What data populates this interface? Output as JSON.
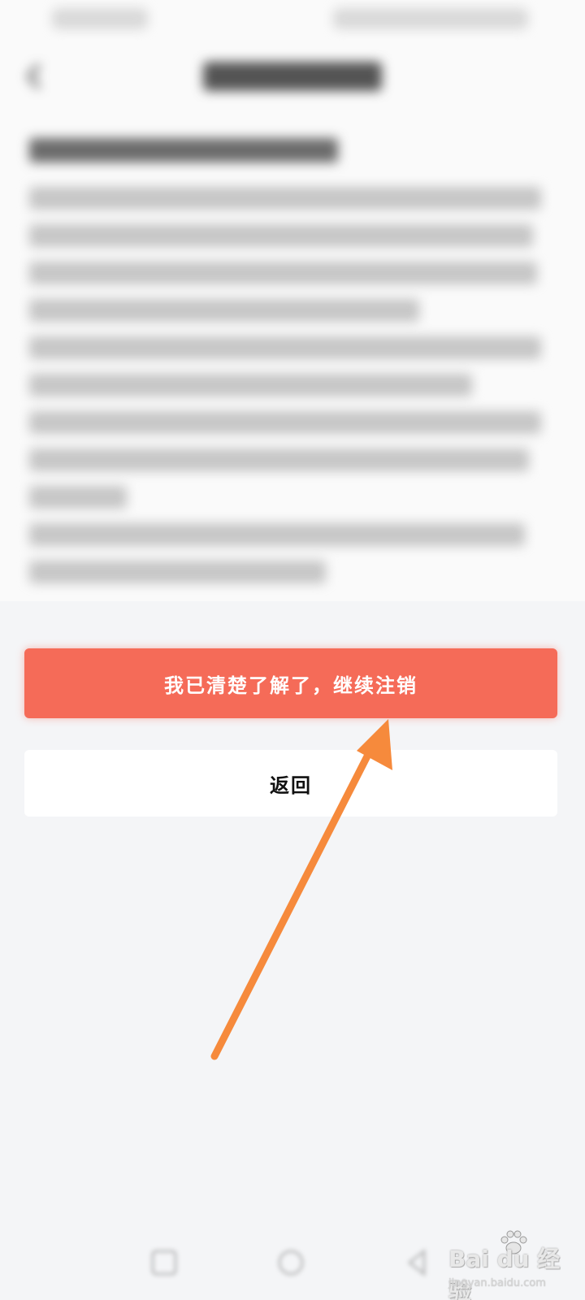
{
  "actions": {
    "confirm_label": "我已清楚了解了，继续注销",
    "back_label": "返回"
  },
  "watermark": {
    "brand": "Bai du 经验",
    "url": "jingyan.baidu.com"
  },
  "colors": {
    "primary_button": "#f56b58",
    "annotation_arrow": "#f68a3c",
    "page_background": "#f4f5f7"
  },
  "icons": [
    "back-arrow-icon",
    "nav-back-icon",
    "nav-home-icon",
    "nav-recent-icon",
    "baidu-paw-icon"
  ]
}
